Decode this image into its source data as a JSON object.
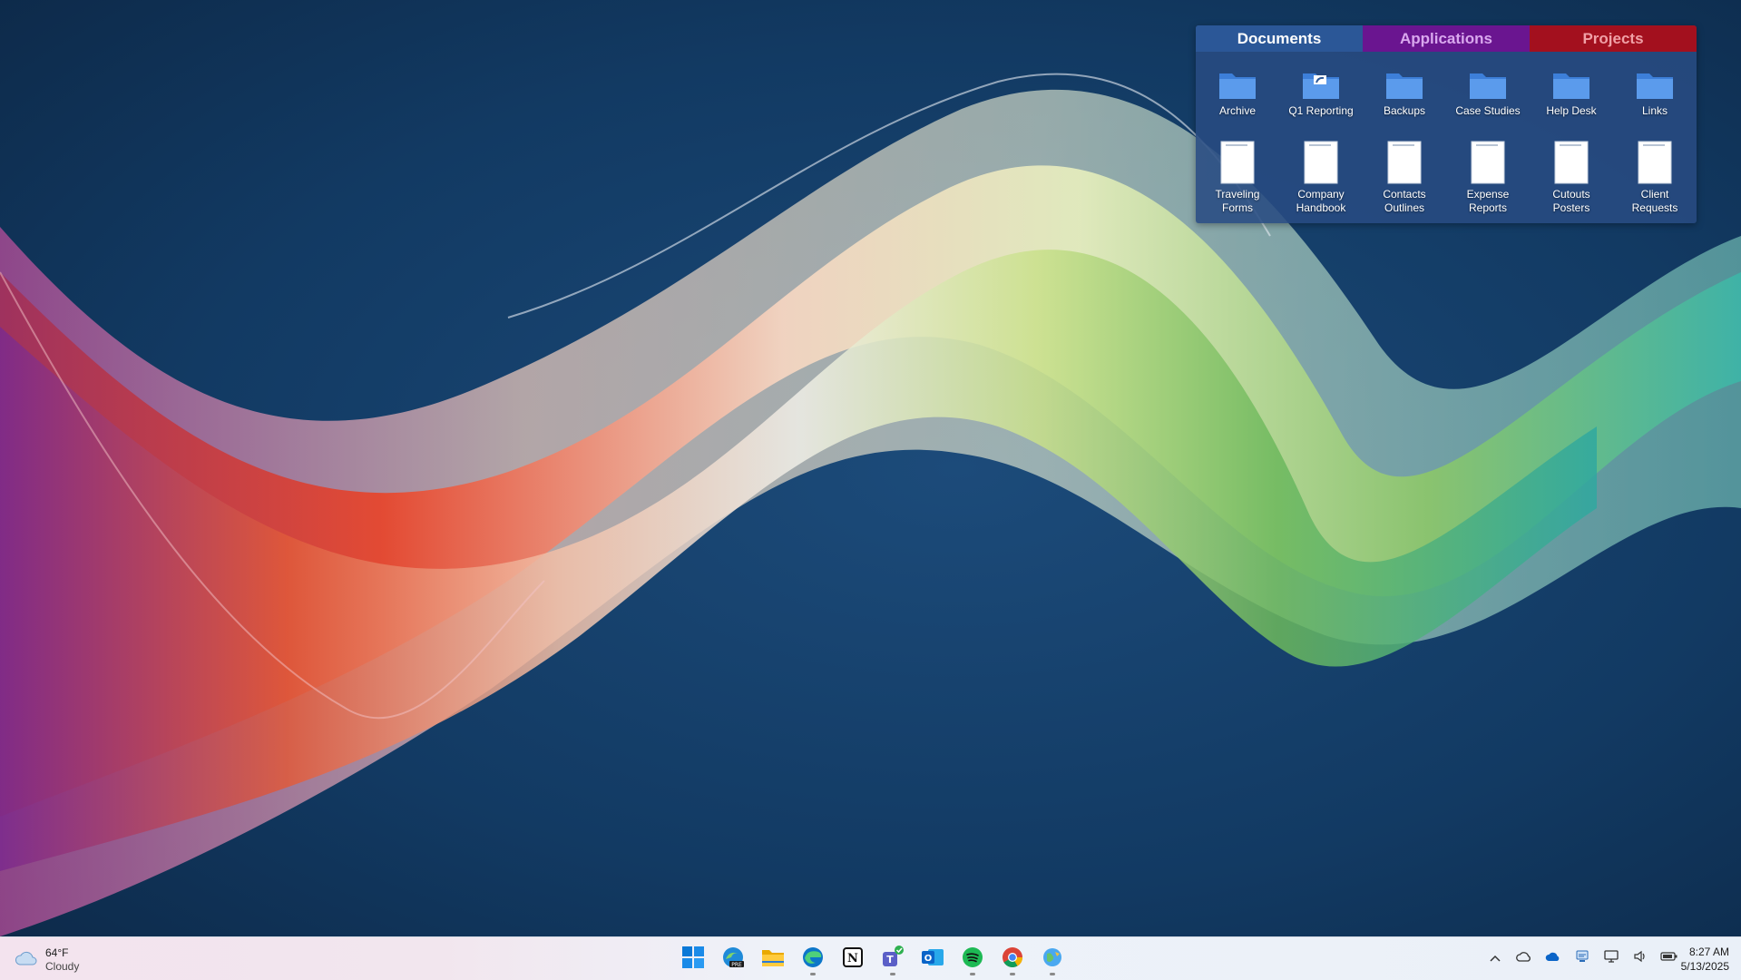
{
  "fence": {
    "tabs": [
      {
        "label": "Documents",
        "color": "#2b5797"
      },
      {
        "label": "Applications",
        "color": "#6a1590"
      },
      {
        "label": "Projects",
        "color": "#a3101e"
      }
    ],
    "items": [
      {
        "label": "Archive",
        "icon": "folder-icon"
      },
      {
        "label": "Q1 Reporting",
        "icon": "folder-shortcut-icon"
      },
      {
        "label": "Backups",
        "icon": "folder-icon"
      },
      {
        "label": "Case Studies",
        "icon": "folder-icon"
      },
      {
        "label": "Help Desk",
        "icon": "folder-icon"
      },
      {
        "label": "Links",
        "icon": "folder-icon"
      },
      {
        "label": "Traveling\nForms",
        "icon": "document-icon"
      },
      {
        "label": "Company\nHandbook",
        "icon": "document-icon"
      },
      {
        "label": "Contacts\nOutlines",
        "icon": "document-icon"
      },
      {
        "label": "Expense\nReports",
        "icon": "document-icon"
      },
      {
        "label": "Cutouts\nPosters",
        "icon": "document-icon"
      },
      {
        "label": "Client\nRequests",
        "icon": "document-icon"
      }
    ]
  },
  "taskbar": {
    "weather": {
      "temp": "64°F",
      "condition": "Cloudy",
      "icon": "cloud-icon"
    },
    "apps": [
      {
        "name": "start",
        "icon": "windows-start-icon"
      },
      {
        "name": "edge-pre",
        "icon": "edge-preview-icon"
      },
      {
        "name": "file-explorer",
        "icon": "folder-icon"
      },
      {
        "name": "edge",
        "icon": "edge-icon"
      },
      {
        "name": "notion",
        "icon": "notion-icon"
      },
      {
        "name": "teams",
        "icon": "teams-icon"
      },
      {
        "name": "outlook",
        "icon": "outlook-icon"
      },
      {
        "name": "spotify",
        "icon": "spotify-icon"
      },
      {
        "name": "chrome",
        "icon": "chrome-icon"
      },
      {
        "name": "maps",
        "icon": "globe-icon"
      }
    ],
    "tray": [
      "chevron-up-icon",
      "cloud-outline-icon",
      "onedrive-icon",
      "network-share-icon",
      "display-icon",
      "speaker-icon",
      "battery-icon"
    ],
    "time": "8:27 AM",
    "date": "5/13/2025"
  }
}
